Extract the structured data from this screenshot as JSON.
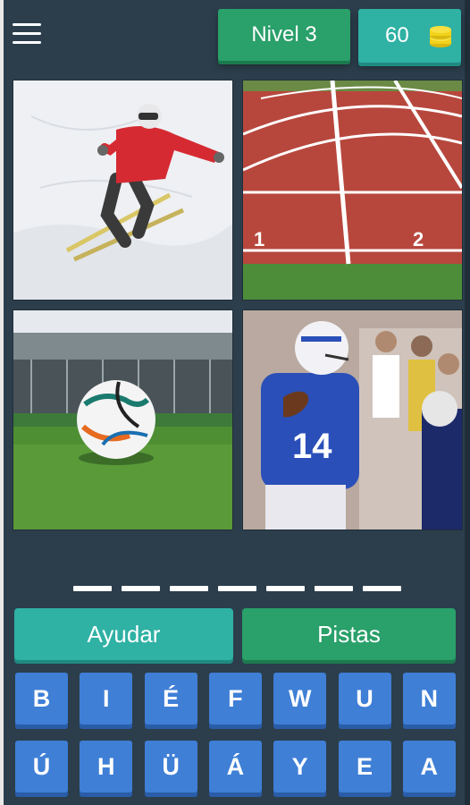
{
  "header": {
    "level_label": "Nivel 3",
    "coins": "60"
  },
  "images": [
    {
      "name": "skier",
      "icon": "skier-photo"
    },
    {
      "name": "running-track",
      "icon": "track-photo"
    },
    {
      "name": "soccer-ball",
      "icon": "soccer-photo"
    },
    {
      "name": "football-player",
      "icon": "football-photo"
    }
  ],
  "track_lane_numbers": [
    "1",
    "2"
  ],
  "jersey_number": "14",
  "answer": {
    "slot_count": 7
  },
  "actions": {
    "help_label": "Ayudar",
    "hints_label": "Pistas"
  },
  "keyboard": {
    "row1": [
      "B",
      "I",
      "É",
      "F",
      "W",
      "U",
      "N"
    ],
    "row2": [
      "Ú",
      "H",
      "Ü",
      "Á",
      "Y",
      "E",
      "A"
    ]
  },
  "colors": {
    "background": "#2c3e4c",
    "level_button": "#2aa06a",
    "coins_button": "#2fb1a4",
    "key": "#3f7fd6",
    "coin": "#f2d21a"
  }
}
